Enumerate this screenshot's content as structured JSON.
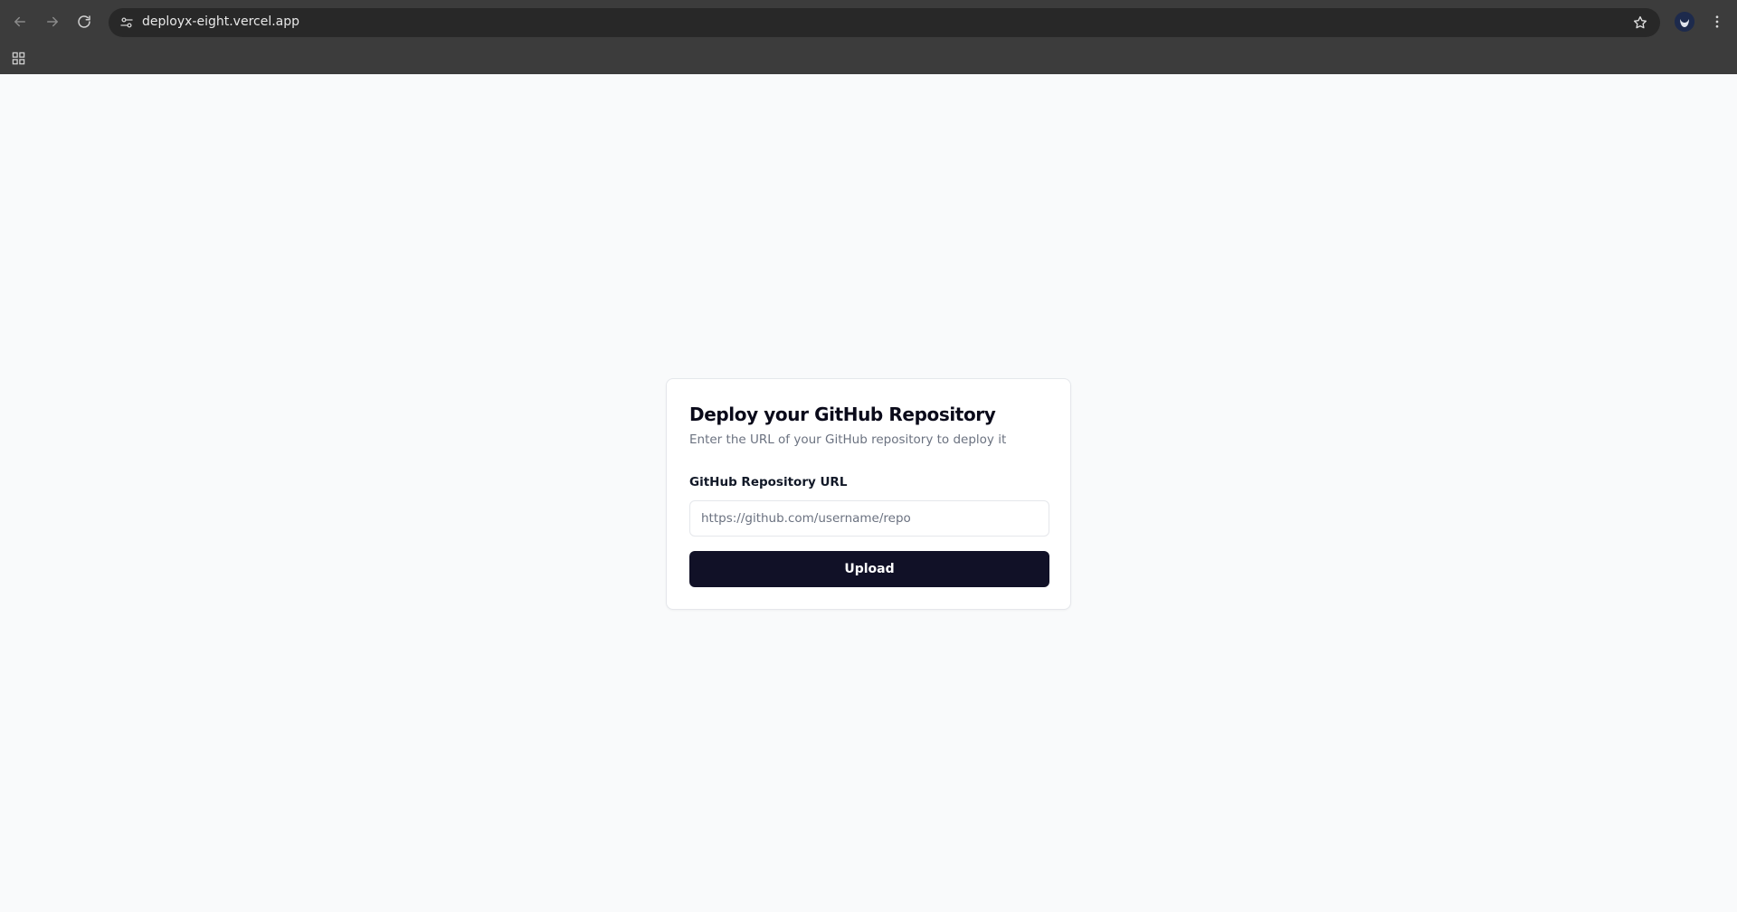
{
  "browser": {
    "url": "deployx-eight.vercel.app",
    "icons": {
      "back": "arrow-left-icon",
      "forward": "arrow-right-icon",
      "reload": "reload-icon",
      "site_info": "tune-icon",
      "bookmark": "star-icon",
      "profile": "avatar",
      "menu": "kebab-icon",
      "apps": "apps-grid-icon"
    }
  },
  "card": {
    "title": "Deploy your GitHub Repository",
    "description": "Enter the URL of your GitHub repository to deploy it",
    "field_label": "GitHub Repository URL",
    "input_value": "",
    "input_placeholder": "https://github.com/username/repo",
    "button_label": "Upload"
  },
  "colors": {
    "page_background": "#f9fafb",
    "button_background": "#111127",
    "chrome_background": "#3c3c3c"
  }
}
